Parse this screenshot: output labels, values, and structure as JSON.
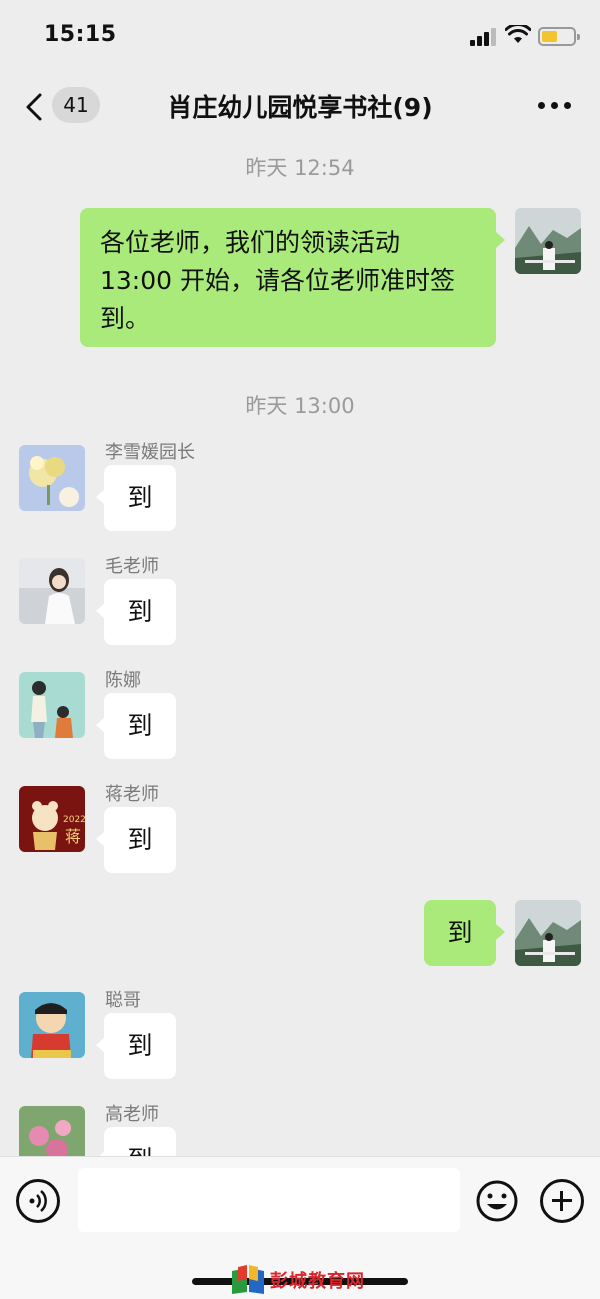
{
  "status_bar": {
    "time": "15:15"
  },
  "nav": {
    "unread_count": "41",
    "title": "肖庄幼儿园悦享书社(9)"
  },
  "messages": [
    {
      "type": "time",
      "text": "昨天 12:54"
    },
    {
      "type": "out",
      "text": "各位老师，我们的领读活动 13:00 开始，请各位老师准时签到。"
    },
    {
      "type": "time",
      "text": "昨天 13:00"
    },
    {
      "type": "in",
      "sender": "李雪媛园长",
      "text": "到"
    },
    {
      "type": "in",
      "sender": "毛老师",
      "text": "到"
    },
    {
      "type": "in",
      "sender": "陈娜",
      "text": "到"
    },
    {
      "type": "in",
      "sender": "蒋老师",
      "text": "到"
    },
    {
      "type": "out",
      "text": "到"
    },
    {
      "type": "in",
      "sender": "聪哥",
      "text": "到"
    },
    {
      "type": "in",
      "sender": "高老师",
      "text": "到"
    }
  ],
  "avatar_art": {
    "jiang_year": "2022",
    "jiang_char": "蒋"
  },
  "input": {
    "value": ""
  },
  "watermark": {
    "text": "彭城教育网"
  },
  "colors": {
    "outgoing_bubble": "#a9ea7a",
    "incoming_bubble": "#ffffff",
    "background": "#ededed"
  }
}
